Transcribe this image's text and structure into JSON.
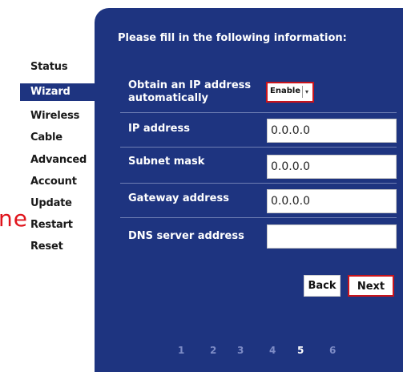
{
  "sidebar": {
    "items": [
      {
        "label": "Status"
      },
      {
        "label": "Wizard"
      },
      {
        "label": "Wireless"
      },
      {
        "label": "Cable"
      },
      {
        "label": "Advanced"
      },
      {
        "label": "Account"
      },
      {
        "label": "Update"
      },
      {
        "label": "Restart"
      },
      {
        "label": "Reset"
      }
    ],
    "active_index": 1,
    "red_fragment": "ne"
  },
  "panel": {
    "title": "Please fill in the following information:",
    "obtain_ip": {
      "label_line1": "Obtain an IP address",
      "label_line2": "automatically",
      "value": "Enable"
    },
    "ip_address": {
      "label": "IP address",
      "value": "0.0.0.0"
    },
    "subnet_mask": {
      "label": "Subnet mask",
      "value": "0.0.0.0"
    },
    "gateway_address": {
      "label": "Gateway address",
      "value": "0.0.0.0"
    },
    "dns_server": {
      "label": "DNS server address",
      "value": ""
    },
    "buttons": {
      "back": "Back",
      "next": "Next"
    },
    "pager": [
      "1",
      "2",
      "3",
      "4",
      "5",
      "6"
    ],
    "current_page": "5"
  },
  "colors": {
    "panel_bg": "#1e3480",
    "highlight_border": "#c8141c"
  }
}
